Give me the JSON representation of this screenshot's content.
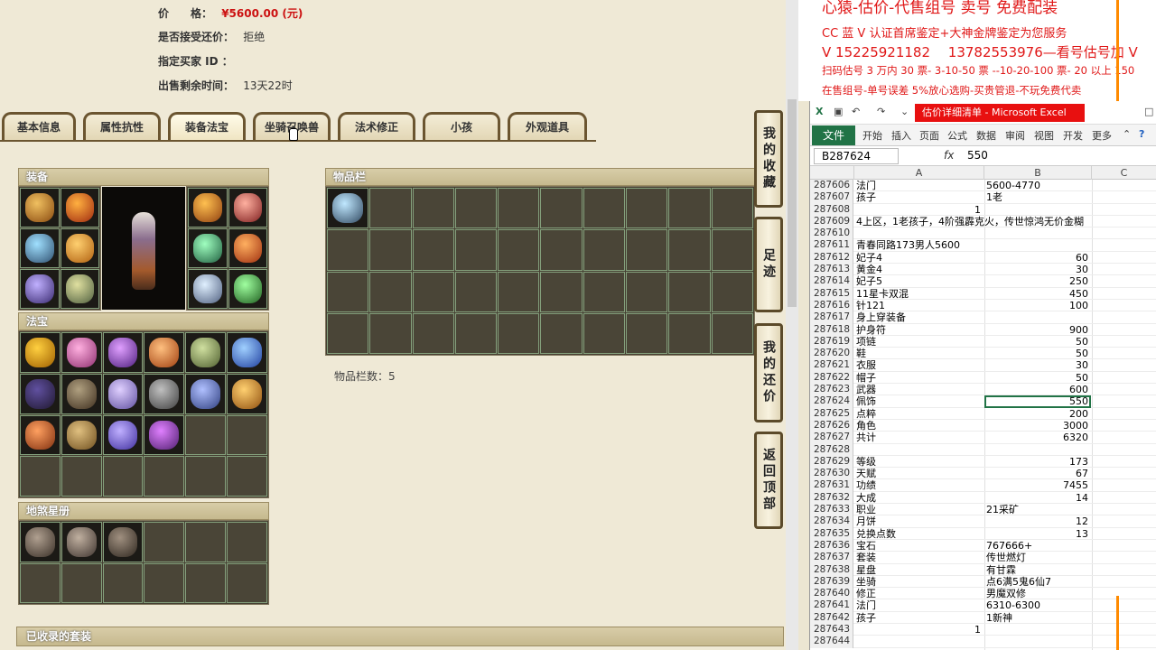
{
  "sale": {
    "price_label": "价　　格：",
    "price": "¥5600.00 (元)",
    "counter_label": "是否接受还价：",
    "counter_value": "拒绝",
    "buyer_label": "指定买家 ID ：",
    "buyer_value": "",
    "time_label": "出售剩余时间：",
    "time_value": "13天22时"
  },
  "tabs": [
    "基本信息",
    "属性抗性",
    "装备法宝",
    "坐骑召唤兽",
    "法术修正",
    "小孩",
    "外观道具"
  ],
  "active_tab": 2,
  "panels": {
    "equip": "装备",
    "fabao": "法宝",
    "disha": "地煞星册",
    "inventory": "物品栏",
    "suits": "已收录的套装"
  },
  "inventory_count_label": "物品栏数：",
  "inventory_count": "5",
  "side_buttons": [
    "我的收藏",
    "足迹",
    "我的还价",
    "返回顶部"
  ],
  "promo": {
    "line1": "心猿-估价-代售组号 卖号 免费配装",
    "line2": "CC 蓝 V 认证首席鉴定+大神金牌鉴定为您服务",
    "line3": "V 15225921182　 13782553976—看号估号加 V",
    "line4": "扫码估号 3 万内 30 票- 3-10-50 票 --10-20-100 票- 20 以上 150",
    "line5": "在售组号-单号误差 5%放心选购-买贵管退-不玩免费代卖"
  },
  "excel": {
    "window_title": "估价详细清单 - Microsoft Excel",
    "file_tab": "文件",
    "ribbon_tabs": [
      "开始",
      "插入",
      "页面",
      "公式",
      "数据",
      "审阅",
      "视图",
      "开发",
      "更多"
    ],
    "namebox": "B287624",
    "formula_value": "550",
    "col_headers": [
      "A",
      "B",
      "C"
    ],
    "rows": [
      {
        "n": "287606",
        "a": "法门",
        "b": "5600-4770",
        "num": false
      },
      {
        "n": "287607",
        "a": "孩子",
        "b": "1老",
        "num": false
      },
      {
        "n": "287608",
        "a": "",
        "b": "1",
        "num": false,
        "b_in_a": true
      },
      {
        "n": "287609",
        "a": "4上区，1老孩子，4阶强霹克火，传世惊鸿无价金糊",
        "b": "",
        "num": false
      },
      {
        "n": "287610",
        "a": "",
        "b": "",
        "num": false
      },
      {
        "n": "287611",
        "a": "青春同路173男人5600",
        "b": "",
        "num": false
      },
      {
        "n": "287612",
        "a": "妃子4",
        "b": "60",
        "num": true
      },
      {
        "n": "287613",
        "a": "黄金4",
        "b": "30",
        "num": true
      },
      {
        "n": "287614",
        "a": "妃子5",
        "b": "250",
        "num": true
      },
      {
        "n": "287615",
        "a": "11星卡双混",
        "b": "450",
        "num": true
      },
      {
        "n": "287616",
        "a": "针121",
        "b": "100",
        "num": true
      },
      {
        "n": "287617",
        "a": "身上穿装备",
        "b": "",
        "num": false
      },
      {
        "n": "287618",
        "a": "护身符",
        "b": "900",
        "num": true
      },
      {
        "n": "287619",
        "a": "项链",
        "b": "50",
        "num": true
      },
      {
        "n": "287620",
        "a": "鞋",
        "b": "50",
        "num": true
      },
      {
        "n": "287621",
        "a": "衣服",
        "b": "30",
        "num": true
      },
      {
        "n": "287622",
        "a": "帽子",
        "b": "50",
        "num": true
      },
      {
        "n": "287623",
        "a": "武器",
        "b": "600",
        "num": true
      },
      {
        "n": "287624",
        "a": "佩饰",
        "b": "550",
        "num": true
      },
      {
        "n": "287625",
        "a": "点粹",
        "b": "200",
        "num": true
      },
      {
        "n": "287626",
        "a": "角色",
        "b": "3000",
        "num": true
      },
      {
        "n": "287627",
        "a": "共计",
        "b": "6320",
        "num": true
      },
      {
        "n": "287628",
        "a": "",
        "b": "",
        "num": false
      },
      {
        "n": "287629",
        "a": "等级",
        "b": "173",
        "num": true
      },
      {
        "n": "287630",
        "a": "天赋",
        "b": "67",
        "num": true
      },
      {
        "n": "287631",
        "a": "功绩",
        "b": "7455",
        "num": true
      },
      {
        "n": "287632",
        "a": "大成",
        "b": "14",
        "num": true
      },
      {
        "n": "287633",
        "a": "职业",
        "b": "21采矿",
        "num": false
      },
      {
        "n": "287634",
        "a": "月饼",
        "b": "12",
        "num": true
      },
      {
        "n": "287635",
        "a": "兑换点数",
        "b": "13",
        "num": true
      },
      {
        "n": "287636",
        "a": "宝石",
        "b": "767666+",
        "num": false
      },
      {
        "n": "287637",
        "a": "套装",
        "b": "传世燃灯",
        "num": false
      },
      {
        "n": "287638",
        "a": "星盘",
        "b": "有甘霖",
        "num": false
      },
      {
        "n": "287639",
        "a": "坐骑",
        "b": "点6满5鬼6仙7",
        "num": false
      },
      {
        "n": "287640",
        "a": "修正",
        "b": "男魔双修",
        "num": false
      },
      {
        "n": "287641",
        "a": "法门",
        "b": "6310-6300",
        "num": false
      },
      {
        "n": "287642",
        "a": "孩子",
        "b": "1新神",
        "num": false
      },
      {
        "n": "287643",
        "a": "",
        "b": "1",
        "num": false,
        "b_in_a": true
      },
      {
        "n": "287644",
        "a": "",
        "b": "",
        "num": false
      }
    ]
  }
}
